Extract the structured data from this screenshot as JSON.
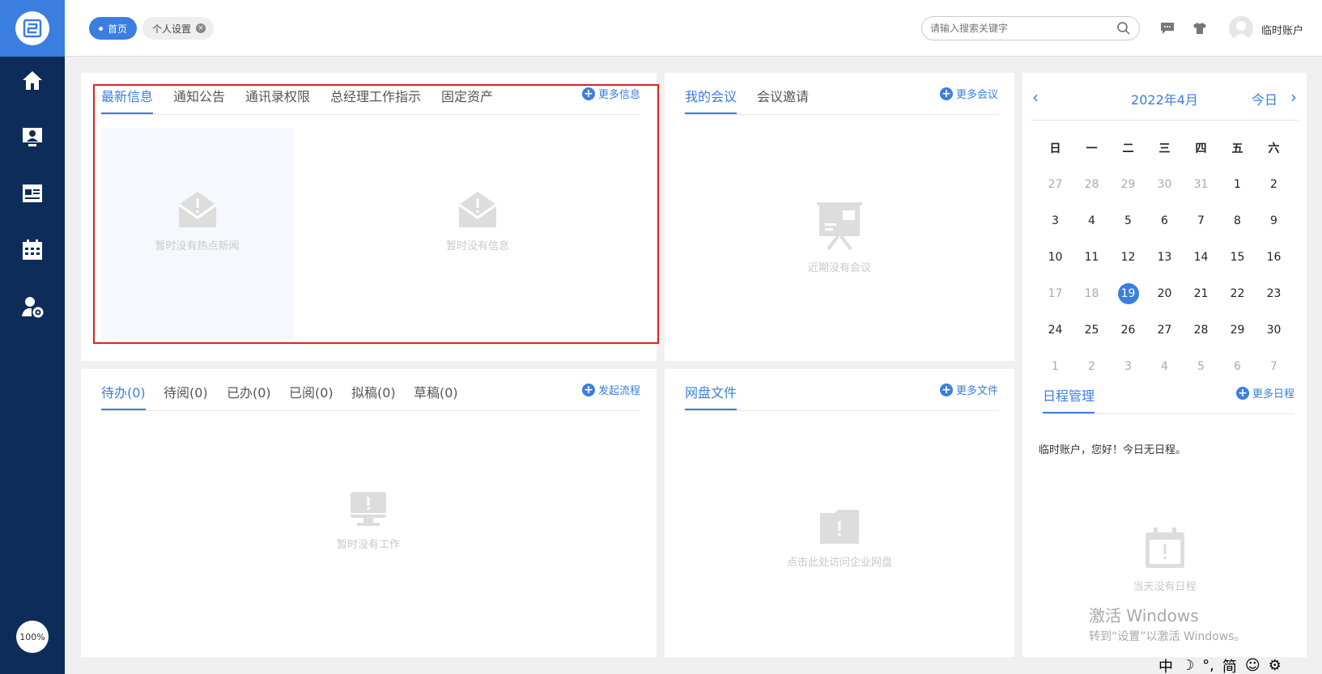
{
  "sidebar": {
    "nav_icons": [
      "home-icon",
      "contacts-icon",
      "news-icon",
      "calendar-icon",
      "user-settings-icon"
    ],
    "zoom": "100%"
  },
  "header": {
    "tab_home": "首页",
    "tab_settings": "个人设置",
    "search_placeholder": "请输入搜索关键字",
    "user_name": "临时账户"
  },
  "info_panel": {
    "tabs": [
      "最新信息",
      "通知公告",
      "通讯录权限",
      "总经理工作指示",
      "固定资产"
    ],
    "more": "更多信息",
    "empty_hot_news": "暂时没有热点新闻",
    "empty_info": "暂时没有信息"
  },
  "meeting_panel": {
    "tabs": [
      "我的会议",
      "会议邀请"
    ],
    "more": "更多会议",
    "empty": "近期没有会议"
  },
  "work_panel": {
    "tabs": [
      "待办(0)",
      "待阅(0)",
      "已办(0)",
      "已阅(0)",
      "拟稿(0)",
      "草稿(0)"
    ],
    "more": "发起流程",
    "empty": "暂时没有工作"
  },
  "disk_panel": {
    "tabs": [
      "网盘文件"
    ],
    "more": "更多文件",
    "empty": "点击此处访问企业网盘"
  },
  "calendar": {
    "month": "2022年4月",
    "today_label": "今日",
    "prev": "‹",
    "next": "›",
    "weekdays": [
      "日",
      "一",
      "二",
      "三",
      "四",
      "五",
      "六"
    ],
    "weeks": [
      [
        "27",
        "28",
        "29",
        "30",
        "31",
        "1",
        "2"
      ],
      [
        "3",
        "4",
        "5",
        "6",
        "7",
        "8",
        "9"
      ],
      [
        "10",
        "11",
        "12",
        "13",
        "14",
        "15",
        "16"
      ],
      [
        "17",
        "18",
        "19",
        "20",
        "21",
        "22",
        "23"
      ],
      [
        "24",
        "25",
        "26",
        "27",
        "28",
        "29",
        "30"
      ],
      [
        "1",
        "2",
        "3",
        "4",
        "5",
        "6",
        "7"
      ]
    ]
  },
  "schedule": {
    "tab": "日程管理",
    "more": "更多日程",
    "greeting": "临时账户，您好！今日无日程。",
    "empty": "当天没有日程"
  },
  "watermark": {
    "line1": "激活 Windows",
    "line2": "转到“设置”以激活 Windows。"
  },
  "ime": [
    "中",
    "☽",
    "°,",
    "简",
    "☺",
    "⚙"
  ]
}
